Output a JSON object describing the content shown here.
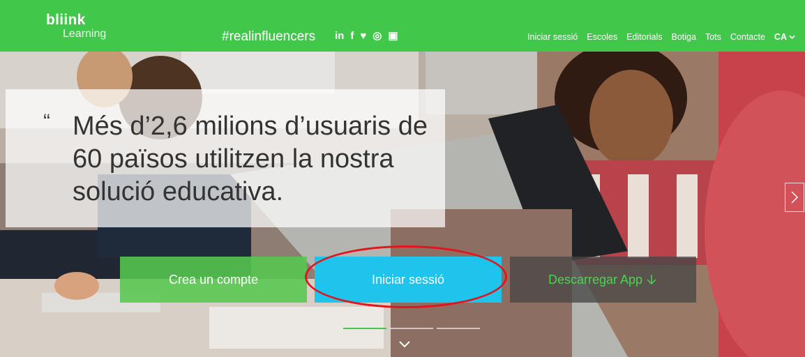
{
  "header": {
    "logo_line1": "bliink",
    "logo_line2": "Learning",
    "hashtag": "#realinfluencers",
    "social": [
      "in",
      "f",
      "♥",
      "◎",
      "▣"
    ],
    "nav": [
      "Iniciar sessió",
      "Escoles",
      "Editorials",
      "Botiga",
      "Tots",
      "Contacte"
    ],
    "language": "CA"
  },
  "hero": {
    "quote_mark": "“",
    "quote_text": "Més d’2,6 milions d’usuaris de 60 països utilitzen la nostra solució educativa."
  },
  "buttons": {
    "create_account": "Crea un compte",
    "login": "Iniciar sessió",
    "download_app": "Descarregar App"
  },
  "colors": {
    "brand_green": "#41c84a",
    "login_button": "#1ec4ec",
    "highlight_circle": "#e2141c"
  },
  "slider": {
    "count": 3,
    "active_index": 1
  }
}
